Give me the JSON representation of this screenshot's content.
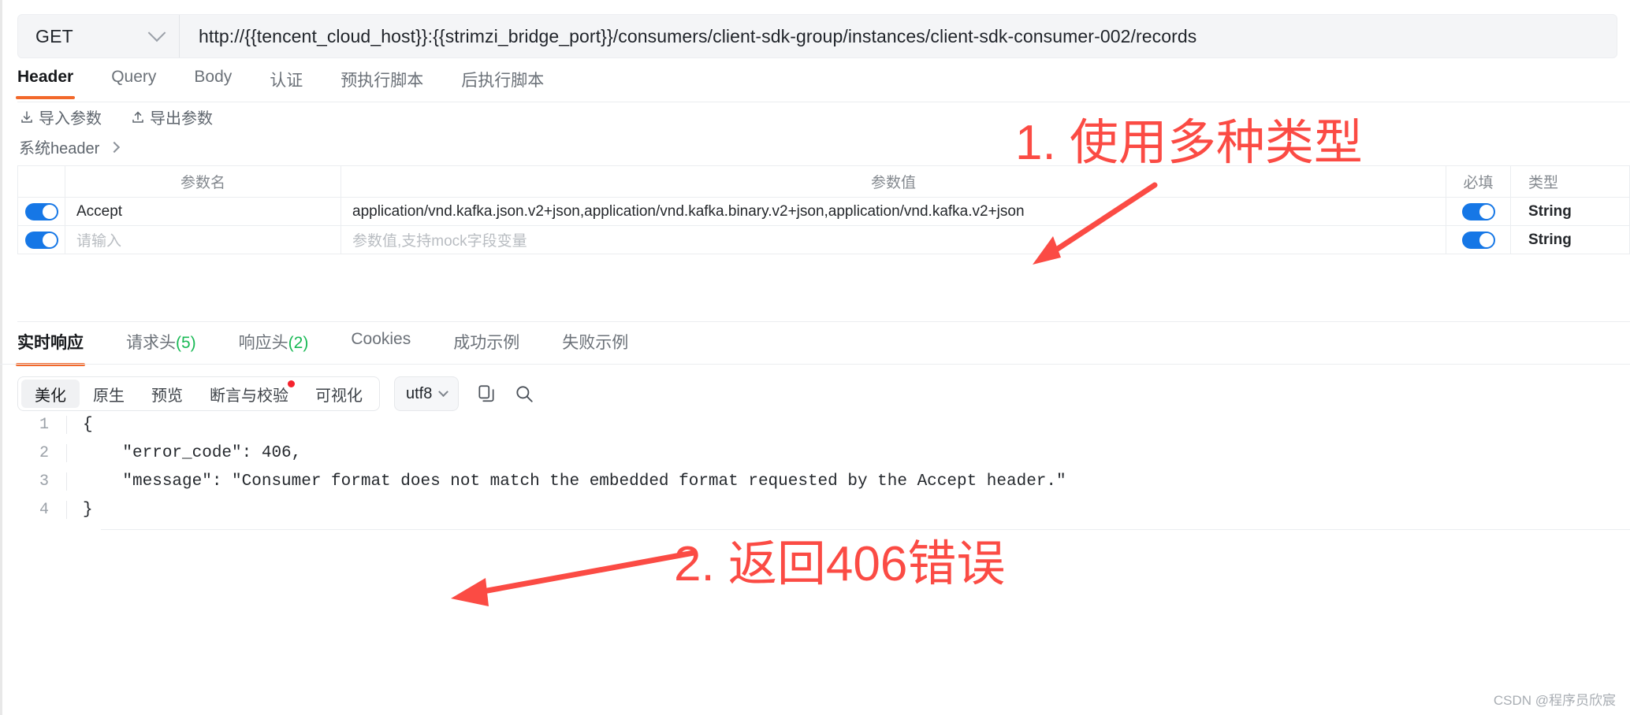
{
  "request": {
    "method": "GET",
    "method_icon": "chevron-down-icon",
    "url": "http://{{tencent_cloud_host}}:{{strimzi_bridge_port}}/consumers/client-sdk-group/instances/client-sdk-consumer-002/records",
    "tabs": [
      {
        "label": "Header",
        "active": true
      },
      {
        "label": "Query",
        "active": false
      },
      {
        "label": "Body",
        "active": false
      },
      {
        "label": "认证",
        "active": false
      },
      {
        "label": "预执行脚本",
        "active": false
      },
      {
        "label": "后执行脚本",
        "active": false
      }
    ],
    "toolbar": {
      "import_label": "导入参数",
      "import_icon": "download-icon",
      "export_label": "导出参数",
      "export_icon": "upload-icon"
    },
    "system_header": {
      "label": "系统header",
      "icon": "chevron-right-icon"
    }
  },
  "param_table": {
    "columns": [
      "",
      "参数名",
      "参数值",
      "必填",
      "类型"
    ],
    "rows": [
      {
        "enabled": true,
        "name": "Accept",
        "name_is_placeholder": false,
        "value": "application/vnd.kafka.json.v2+json,application/vnd.kafka.binary.v2+json,application/vnd.kafka.v2+json",
        "value_is_placeholder": false,
        "required": true,
        "type": "String"
      },
      {
        "enabled": true,
        "name": "请输入",
        "name_is_placeholder": true,
        "value": "参数值,支持mock字段变量",
        "value_is_placeholder": true,
        "required": true,
        "type": "String"
      }
    ]
  },
  "response": {
    "tabs": [
      {
        "label": "实时响应",
        "count": "",
        "active": true
      },
      {
        "label": "请求头",
        "count": "(5)",
        "active": false
      },
      {
        "label": "响应头",
        "count": "(2)",
        "active": false
      },
      {
        "label": "Cookies",
        "count": "",
        "active": false
      },
      {
        "label": "成功示例",
        "count": "",
        "active": false
      },
      {
        "label": "失败示例",
        "count": "",
        "active": false
      }
    ],
    "view_modes": [
      {
        "label": "美化",
        "active": true,
        "badge": false
      },
      {
        "label": "原生",
        "active": false,
        "badge": false
      },
      {
        "label": "预览",
        "active": false,
        "badge": false
      },
      {
        "label": "断言与校验",
        "active": false,
        "badge": true
      },
      {
        "label": "可视化",
        "active": false,
        "badge": false
      }
    ],
    "encoding": {
      "value": "utf8",
      "icon": "chevron-down-icon"
    },
    "actions": [
      {
        "icon": "copy-icon",
        "name": "copy-button"
      },
      {
        "icon": "search-icon",
        "name": "search-button"
      }
    ],
    "body_lines": [
      {
        "num": "1",
        "text": "{"
      },
      {
        "num": "2",
        "text": "    \"error_code\": 406,"
      },
      {
        "num": "3",
        "text": "    \"message\": \"Consumer format does not match the embedded format requested by the Accept header.\""
      },
      {
        "num": "4",
        "text": "}"
      }
    ]
  },
  "annotations": [
    {
      "id": "anno1",
      "text": "1. 使用多种类型",
      "color": "#fb4b44"
    },
    {
      "id": "anno2",
      "text": "2. 返回406错误",
      "color": "#fb4b44"
    }
  ],
  "watermark": "CSDN @程序员欣宸",
  "colors": {
    "accent_orange": "#f2682a",
    "toggle_blue": "#1677e6",
    "count_green": "#19b955",
    "annotation_red": "#fb4b44",
    "badge_red": "#f5222d"
  }
}
